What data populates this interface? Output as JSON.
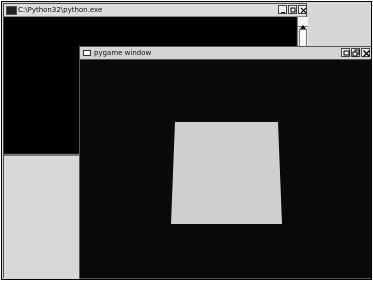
{
  "console_window": {
    "title": "C:\\Python32\\python.exe",
    "icon": "console-icon",
    "buttons": [
      "minimize-icon",
      "maximize-icon",
      "close-icon"
    ]
  },
  "pygame_window": {
    "title": "pygame window",
    "icon": "window-icon",
    "buttons": [
      "minimize-icon",
      "maximize-icon",
      "close-icon"
    ],
    "shape_color": "#cfcfcf",
    "background_color": "#0a0a0a"
  }
}
